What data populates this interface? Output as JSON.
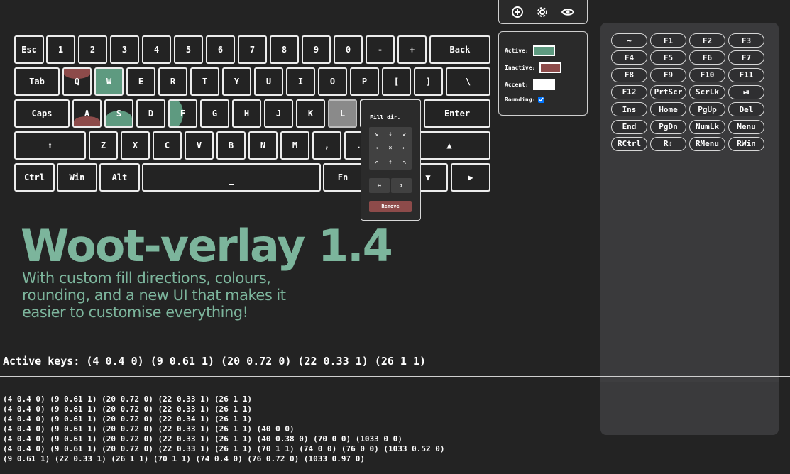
{
  "colors": {
    "background": "#232323",
    "active": "#5e9a80",
    "inactive": "#8d4b4a",
    "accent": "#ffffff",
    "headline": "#7cb59c",
    "key_border": "#ececec"
  },
  "toolbar": {
    "icons": [
      "add-icon",
      "gear-icon",
      "eye-icon"
    ]
  },
  "settings": {
    "active_label": "Active:",
    "inactive_label": "Inactive:",
    "accent_label": "Accent:",
    "rounding_label": "Rounding:",
    "rounding_checked": true
  },
  "keyboard": {
    "rows": [
      [
        "Esc",
        "1",
        "2",
        "3",
        "4",
        "5",
        "6",
        "7",
        "8",
        "9",
        "0",
        "-",
        "+",
        "Back"
      ],
      [
        "Tab",
        "Q",
        "W",
        "E",
        "R",
        "T",
        "Y",
        "U",
        "I",
        "O",
        "P",
        "[",
        "]",
        "\\"
      ],
      [
        "Caps",
        "A",
        "S",
        "D",
        "F",
        "G",
        "H",
        "J",
        "K",
        "L",
        ";",
        "'",
        "Enter"
      ],
      [
        "shift-arrow-icon",
        "Z",
        "X",
        "C",
        "V",
        "B",
        "N",
        "M",
        ",",
        ".",
        "/",
        "▲"
      ],
      [
        "Ctrl",
        "Win",
        "Alt",
        "_",
        "Fn",
        "◀",
        "▼",
        "▶"
      ]
    ],
    "fill_levels": {
      "Q": {
        "level": 0.4,
        "color": "inactive",
        "direction": "down"
      },
      "W": {
        "level": 1.0,
        "color": "active",
        "direction": "full"
      },
      "A": {
        "level": 0.4,
        "color": "inactive",
        "direction": "up"
      },
      "S": {
        "level": 0.6,
        "color": "active",
        "direction": "up"
      },
      "F": {
        "level": 0.5,
        "color": "active",
        "direction": "left"
      },
      "L": {
        "level": 1.0,
        "color": "selected",
        "direction": "full"
      }
    }
  },
  "popup": {
    "title": "Fill dir.",
    "arrows": [
      "↘",
      "↓",
      "↙",
      "→",
      "×",
      "←",
      "↗",
      "↑",
      "↖"
    ],
    "extra": [
      "↔",
      "↕"
    ],
    "remove_label": "Remove"
  },
  "available_keys": [
    "~",
    "F1",
    "F2",
    "F3",
    "F4",
    "F5",
    "F6",
    "F7",
    "F8",
    "F9",
    "F10",
    "F11",
    "F12",
    "PrtScr",
    "ScrLk",
    "⏯",
    "Ins",
    "Home",
    "PgUp",
    "Del",
    "End",
    "PgDn",
    "NumLk",
    "Menu",
    "RCtrl",
    "R⇧",
    "RMenu",
    "RWin"
  ],
  "promo": {
    "title": "Woot-verlay 1.4",
    "subtitle_lines": [
      "With custom fill directions, colours,",
      "rounding, and a new UI that makes it",
      "easier to customise everything!"
    ]
  },
  "active_keys_line": "Active keys: (4 0.4 0) (9 0.61 1) (20 0.72 0) (22 0.33 1) (26 1 1)",
  "log_lines": [
    "(4 0.4 0) (9 0.61 1) (20 0.72 0) (22 0.33 1) (26 1 1)",
    "(4 0.4 0) (9 0.61 1) (20 0.72 0) (22 0.33 1) (26 1 1)",
    "(4 0.4 0) (9 0.61 1) (20 0.72 0) (22 0.34 1) (26 1 1)",
    "(4 0.4 0) (9 0.61 1) (20 0.72 0) (22 0.33 1) (26 1 1) (40 0 0)",
    "(4 0.4 0) (9 0.61 1) (20 0.72 0) (22 0.33 1) (26 1 1) (40 0.38 0) (70 0 0) (1033 0 0)",
    "(4 0.4 0) (9 0.61 1) (20 0.72 0) (22 0.33 1) (26 1 1) (70 1 1) (74 0 0) (76 0 0) (1033 0.52 0)",
    "(9 0.61 1) (22 0.33 1) (26 1 1) (70 1 1) (74 0.4 0) (76 0.72 0) (1033 0.97 0)"
  ]
}
